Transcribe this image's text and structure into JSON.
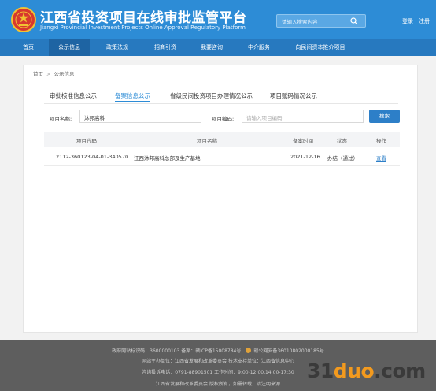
{
  "header": {
    "title": "江西省投资项目在线审批监管平台",
    "subtitle": "Jiangxi Provincial Investment Projects Online Approval Regulatory Platform",
    "search_placeholder": "请输入搜索内容",
    "login": "登录",
    "register": "注册",
    "brand_color": "#2d8cd6"
  },
  "nav": {
    "items": [
      "首页",
      "公示信息",
      "政策法规",
      "招商引资",
      "我要咨询",
      "中介服务",
      "向民间资本推介项目"
    ],
    "active_index": 1
  },
  "breadcrumb": [
    "首页",
    "公示信息"
  ],
  "tabs": {
    "items": [
      "审批核准信息公示",
      "备案信息公示",
      "省级民间投资项目办理情况公示",
      "项目赋码情况公示"
    ],
    "active_index": 1
  },
  "filters": {
    "project_name_label": "项目名称:",
    "project_name_value": "沐邦高科",
    "project_code_label": "项目编码:",
    "project_code_placeholder": "请输入项目编码",
    "search_button": "搜索"
  },
  "table": {
    "columns": [
      "项目代码",
      "项目名称",
      "备案时间",
      "状态",
      "操作"
    ],
    "rows": [
      {
        "code": "2112-360123-04-01-340570",
        "name": "江西沐邦高科总部及生产基地",
        "date": "2021-12-16",
        "status": "办结（通过）",
        "action": "查看"
      }
    ]
  },
  "footer": {
    "line1_a": "政府网站标识码：3600000103   备案：赣ICP备15008784号",
    "line1_b": "赣公网安备36010802000185号",
    "line2": "网站主办单位：江西省发展和改革委员会   技术支持单位：江西省信息中心",
    "line3": "咨询投诉电话：0791-88901501   工作时间：9:00-12:00,14:00-17:30",
    "line4": "江西省发展和改革委员会 版权所有，如需转载，请注明来源"
  },
  "watermark": {
    "part1": "31",
    "part2": "duo",
    "part3": ".com"
  }
}
